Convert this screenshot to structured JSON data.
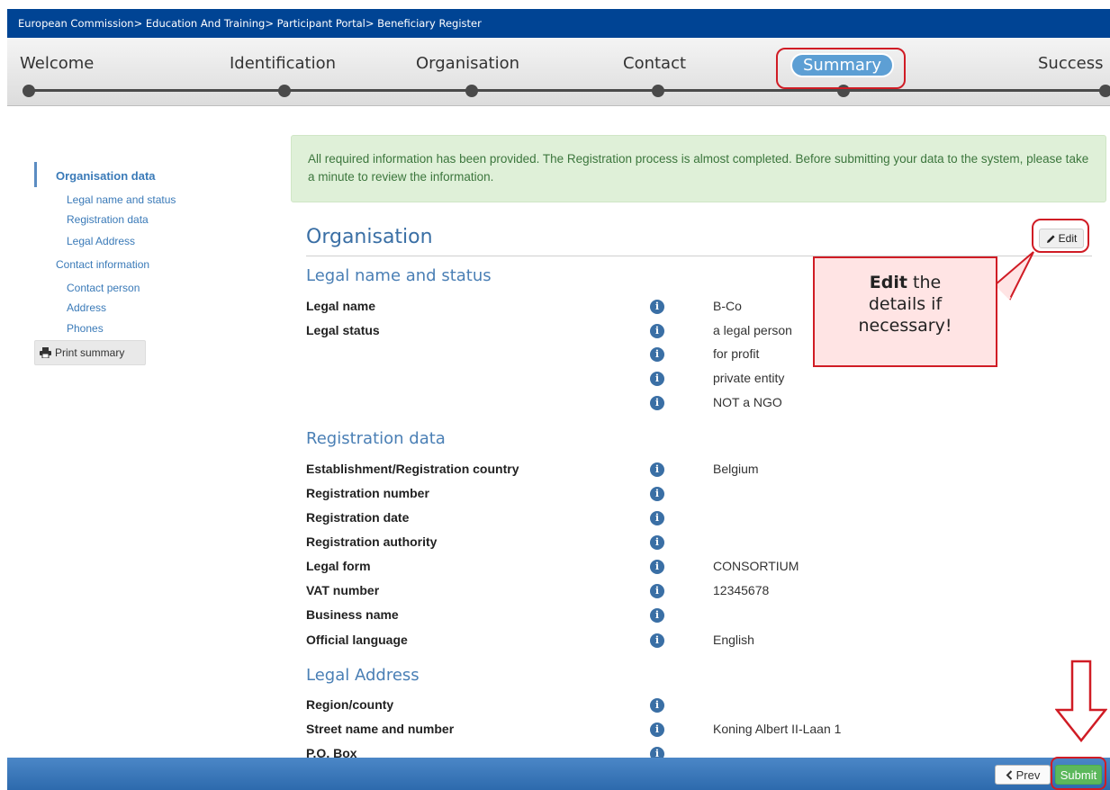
{
  "breadcrumb": {
    "items": [
      "European Commission",
      "Education And Training",
      "Participant Portal",
      "Beneficiary Register"
    ],
    "separator": ">"
  },
  "wizard": {
    "steps": [
      "Welcome",
      "Identification",
      "Organisation",
      "Contact",
      "Summary",
      "Success"
    ],
    "active_step": "Summary"
  },
  "sidebar": {
    "group1": "Organisation data",
    "group1_items": [
      "Legal name and status",
      "Registration data",
      "Legal Address"
    ],
    "group2": "Contact information",
    "group2_items": [
      "Contact person",
      "Address",
      "Phones"
    ],
    "print_label": "Print summary"
  },
  "alert": {
    "text": "All required information has been provided. The Registration process is almost completed. Before submitting your data to the system, please take a minute to review the information."
  },
  "main": {
    "title": "Organisation",
    "edit_label": "Edit",
    "sections": [
      {
        "title": "Legal name and status",
        "rows": [
          {
            "label": "Legal name",
            "value": "B-Co"
          },
          {
            "label": "Legal status",
            "value": "a legal person"
          },
          {
            "label": "",
            "value": "for profit"
          },
          {
            "label": "",
            "value": "private entity"
          },
          {
            "label": "",
            "value": "NOT a NGO"
          }
        ]
      },
      {
        "title": "Registration data",
        "rows": [
          {
            "label": "Establishment/Registration country",
            "value": "Belgium"
          },
          {
            "label": "Registration number",
            "value": ""
          },
          {
            "label": "Registration date",
            "value": ""
          },
          {
            "label": "Registration authority",
            "value": ""
          },
          {
            "label": "Legal form",
            "value": "CONSORTIUM"
          },
          {
            "label": "VAT number",
            "value": "12345678"
          },
          {
            "label": "Business name",
            "value": ""
          },
          {
            "label": "Official language",
            "value": "English"
          }
        ]
      },
      {
        "title": "Legal Address",
        "rows": [
          {
            "label": "Region/county",
            "value": ""
          },
          {
            "label": "Street name and number",
            "value": "Koning Albert II-Laan 1"
          },
          {
            "label": "P.O. Box",
            "value": ""
          }
        ]
      }
    ]
  },
  "callout": {
    "bold": "Edit",
    "rest_line1": " the",
    "line2": "details if",
    "line3": "necessary!"
  },
  "footer": {
    "prev_label": "Prev",
    "submit_label": "Submit"
  },
  "colors": {
    "topbar": "#004494",
    "accent": "#3a6fa5",
    "highlight": "#d01c25",
    "submit": "#5cb85c"
  }
}
